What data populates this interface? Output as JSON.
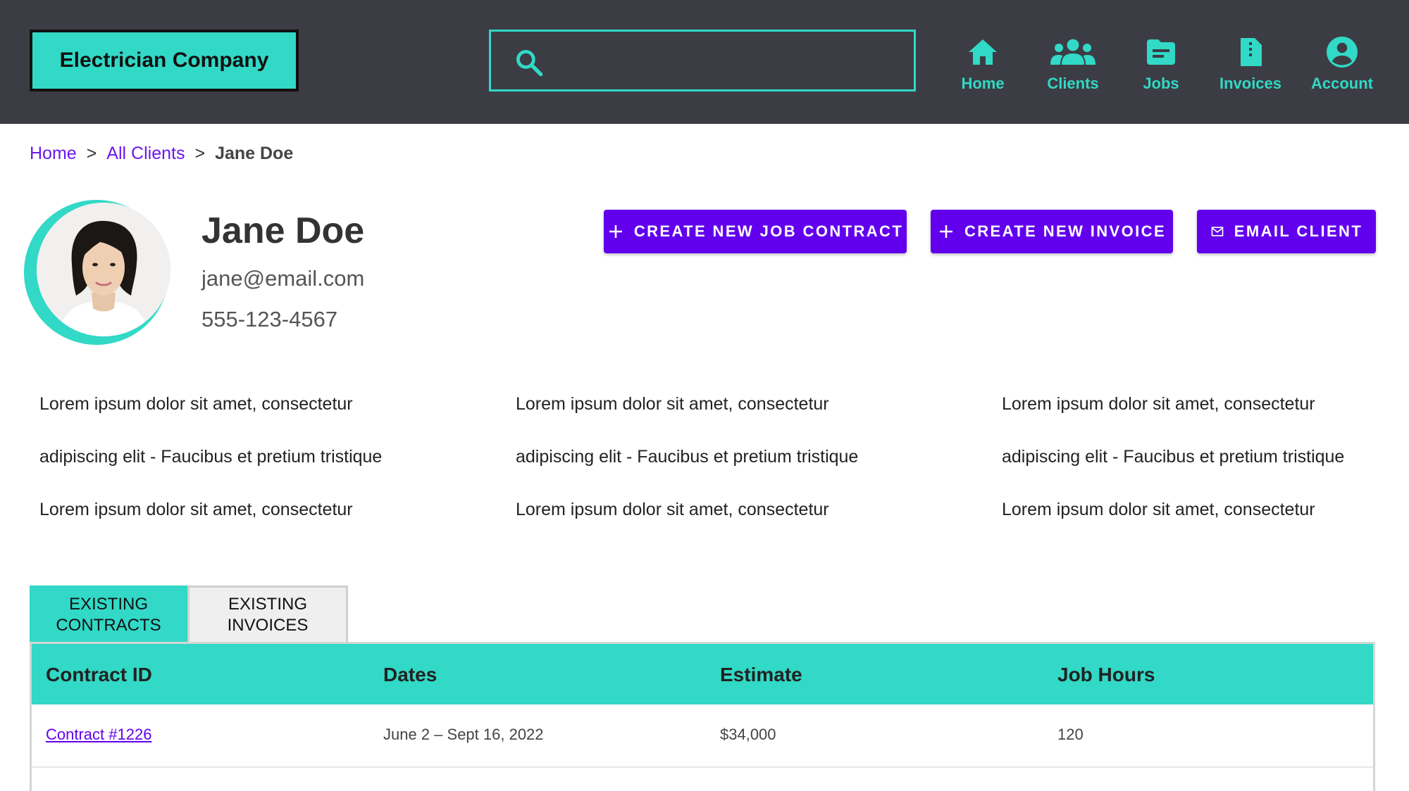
{
  "header": {
    "brand": "Electrician Company",
    "nav": [
      {
        "label": "Home",
        "icon": "home-icon"
      },
      {
        "label": "Clients",
        "icon": "clients-icon"
      },
      {
        "label": "Jobs",
        "icon": "jobs-icon"
      },
      {
        "label": "Invoices",
        "icon": "invoices-icon"
      },
      {
        "label": "Account",
        "icon": "account-icon"
      }
    ]
  },
  "breadcrumb": {
    "items": [
      "Home",
      "All Clients"
    ],
    "separator": ">",
    "current": "Jane Doe"
  },
  "client": {
    "name": "Jane Doe",
    "email": "jane@email.com",
    "phone": "555-123-4567"
  },
  "actions": {
    "create_job": "CREATE NEW JOB CONTRACT",
    "create_invoice": "CREATE NEW INVOICE",
    "email_client": "EMAIL CLIENT"
  },
  "info": {
    "columns": [
      [
        "Lorem ipsum dolor sit amet, consectetur",
        "adipiscing elit - Faucibus et pretium tristique",
        "Lorem ipsum dolor sit amet, consectetur"
      ],
      [
        "Lorem ipsum dolor sit amet, consectetur",
        "adipiscing elit - Faucibus et pretium tristique",
        "Lorem ipsum dolor sit amet, consectetur"
      ],
      [
        "Lorem ipsum dolor sit amet, consectetur",
        "adipiscing elit - Faucibus et pretium tristique",
        "Lorem ipsum dolor sit amet, consectetur"
      ]
    ]
  },
  "tabs": [
    {
      "line1": "EXISTING",
      "line2": "CONTRACTS",
      "active": true
    },
    {
      "line1": "EXISTING",
      "line2": "INVOICES",
      "active": false
    }
  ],
  "table": {
    "headers": [
      "Contract ID",
      "Dates",
      "Estimate",
      "Job Hours"
    ],
    "rows": [
      [
        "Contract #1226",
        "June 2 – Sept 16, 2022",
        "$34,000",
        "120"
      ]
    ]
  },
  "colors": {
    "accent": "#31d9c6",
    "primary": "#6200ee",
    "header_bg": "#3c3c44",
    "link": "#6a18ee"
  }
}
